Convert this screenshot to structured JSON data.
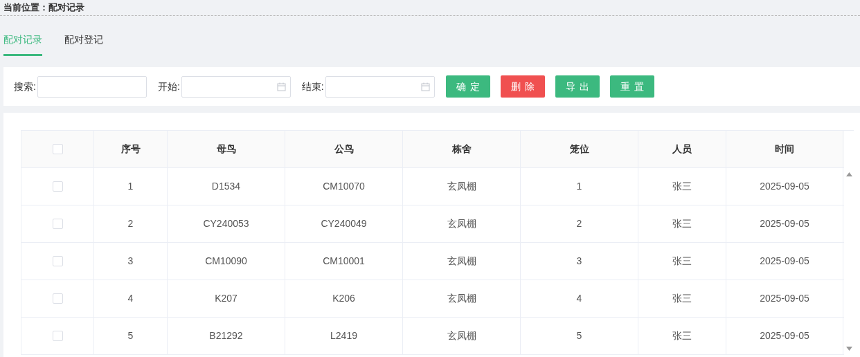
{
  "breadcrumb": {
    "label": "当前位置：",
    "current": "配对记录"
  },
  "tabs": [
    {
      "label": "配对记录",
      "selected": true
    },
    {
      "label": "配对登记",
      "selected": false
    }
  ],
  "filters": [
    {
      "label": "搜索:",
      "kind": "text"
    },
    {
      "label": "开始:",
      "kind": "date"
    },
    {
      "label": "结束:",
      "kind": "date"
    }
  ],
  "buttons": [
    {
      "label": "确定",
      "kind": "primary"
    },
    {
      "label": "删除",
      "kind": "danger"
    },
    {
      "label": "导出",
      "kind": "primary"
    },
    {
      "label": "重置",
      "kind": "primary"
    }
  ],
  "table": {
    "select_all": {
      "checked": false
    },
    "columns": [
      "序号",
      "母鸟",
      "公鸟",
      "栋舍",
      "笼位",
      "人员",
      "时间"
    ],
    "rows": [
      {
        "checked": false,
        "cells": [
          "1",
          "D1534",
          "CM10070",
          "玄凤棚",
          "1",
          "张三",
          "2025-09-05"
        ]
      },
      {
        "checked": false,
        "cells": [
          "2",
          "CY240053",
          "CY240049",
          "玄凤棚",
          "2",
          "张三",
          "2025-09-05"
        ]
      },
      {
        "checked": false,
        "cells": [
          "3",
          "CM10090",
          "CM10001",
          "玄凤棚",
          "3",
          "张三",
          "2025-09-05"
        ]
      },
      {
        "checked": false,
        "cells": [
          "4",
          "K207",
          "K206",
          "玄凤棚",
          "4",
          "张三",
          "2025-09-05"
        ]
      },
      {
        "checked": false,
        "cells": [
          "5",
          "B21292",
          "L2419",
          "玄凤棚",
          "5",
          "张三",
          "2025-09-05"
        ]
      }
    ]
  }
}
